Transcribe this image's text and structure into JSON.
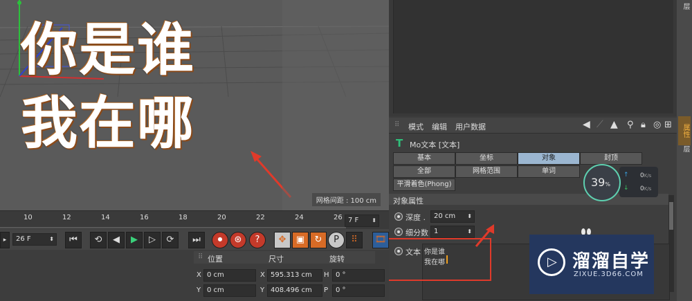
{
  "viewport": {
    "line1": "你是谁",
    "line2": "我在哪",
    "grid_label": "网格间距 : 100 cm"
  },
  "attr": {
    "menu": [
      "模式",
      "编辑",
      "用户数据"
    ],
    "object_name": "Mo文本 [文本]",
    "tabs_row1": [
      "基本",
      "坐标",
      "对象",
      "封顶"
    ],
    "tabs_row2": [
      "全部",
      "网格范围",
      "单词"
    ],
    "phong_tab": "平滑着色(Phong)",
    "section_title": "对象属性",
    "depth_label": "深度 .",
    "depth_value": "20 cm",
    "subdiv_label": "细分数",
    "subdiv_value": "1",
    "text_label": "文本",
    "text_line1": "你是谁",
    "text_line2": "我在哪",
    "active_tab": "对象"
  },
  "right_tabs": [
    "层",
    "属性",
    "层"
  ],
  "timeline": {
    "ticks": [
      "10",
      "12",
      "14",
      "16",
      "18",
      "20",
      "22",
      "24",
      "26"
    ],
    "end_frame": "7 F",
    "current_frame": "26 F"
  },
  "coords": {
    "headers": [
      "位置",
      "尺寸",
      "旋转"
    ],
    "rows": [
      {
        "axis": "X",
        "pos": "0 cm",
        "size_axis": "X",
        "size": "595.313 cm",
        "rot_axis": "H",
        "rot": "0 °"
      },
      {
        "axis": "Y",
        "pos": "0 cm",
        "size_axis": "Y",
        "size": "408.496 cm",
        "rot_axis": "P",
        "rot": "0 °"
      }
    ]
  },
  "net_widget": {
    "percent": "39",
    "percent_sign": "%",
    "up": "0",
    "down": "0",
    "unit": "K/s"
  },
  "watermark": {
    "title": "溜溜自学",
    "url": "ZIXUE.3D66.COM"
  },
  "colors": {
    "accent_active_tab": "#9bb6d0",
    "annotation_red": "#e03a2a",
    "text_t_icon": "#2fbf7a"
  }
}
